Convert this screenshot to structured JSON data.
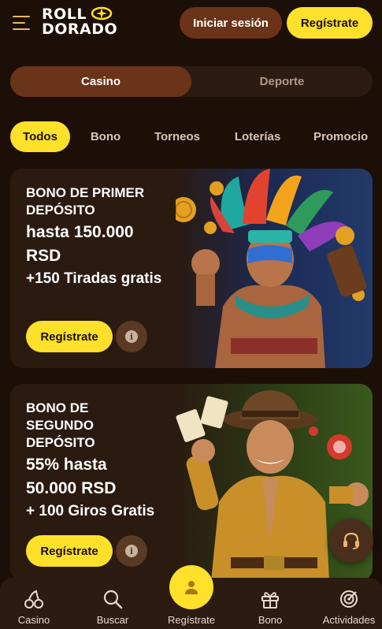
{
  "header": {
    "logo_line1": "ROLL",
    "logo_line2": "DORADO",
    "login_label": "Iniciar sesión",
    "register_label": "Regístrate"
  },
  "section_toggle": {
    "options": [
      "Casino",
      "Deporte"
    ],
    "active": "Casino"
  },
  "category_tabs": {
    "items": [
      "Todos",
      "Bono",
      "Torneos",
      "Loterías",
      "Promocio"
    ],
    "active": "Todos"
  },
  "promos": [
    {
      "line1": "BONO DE PRIMER",
      "line2": "DEPÓSITO",
      "line3": "hasta 150.000",
      "line4": "RSD",
      "line5": "+150 Tiradas gratis",
      "button_label": "Regístrate",
      "info_icon": "i"
    },
    {
      "line1": "BONO DE",
      "line2": "SEGUNDO",
      "line3": "DEPÓSITO",
      "line4": "55% hasta",
      "line5": "50.000 RSD",
      "line6": "+ 100 Giros Gratis",
      "button_label": "Regístrate",
      "info_icon": "i"
    }
  ],
  "bottom_nav": {
    "items": [
      "Casino",
      "Buscar",
      "Regístrate",
      "Bono",
      "Actividades"
    ]
  },
  "colors": {
    "background": "#1c0f07",
    "accent_yellow": "#ffe02a",
    "brown_button": "#6b3418",
    "nav_bg": "#2b1b11"
  },
  "icons": {
    "menu": "hamburger-icon",
    "support": "headset-icon",
    "info": "info-icon",
    "nav": [
      "cherries-icon",
      "search-icon",
      "user-icon",
      "gift-icon",
      "target-icon"
    ]
  }
}
